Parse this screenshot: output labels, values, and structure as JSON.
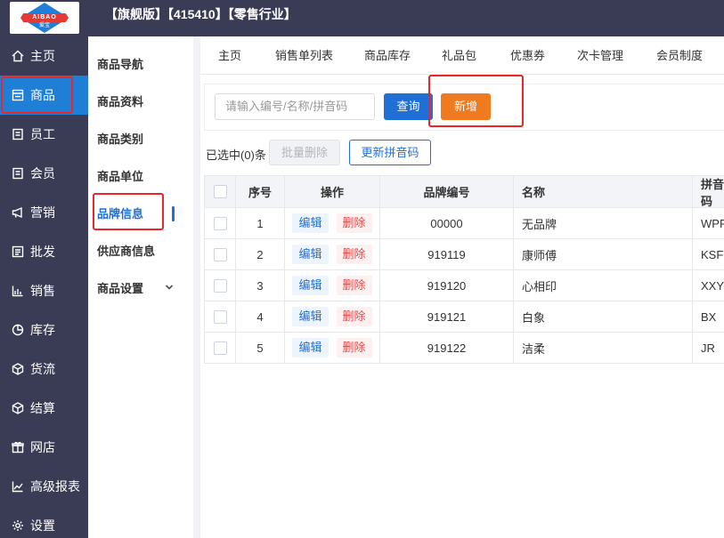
{
  "header": {
    "title": "【旗舰版】【415410】【零售行业】",
    "logo_text": "AIBAO",
    "logo_sub": "爱宝"
  },
  "sidebar": {
    "items": [
      {
        "label": "主页",
        "icon": "home-icon"
      },
      {
        "label": "商品",
        "icon": "goods-icon",
        "active": true
      },
      {
        "label": "员工",
        "icon": "employee-icon"
      },
      {
        "label": "会员",
        "icon": "member-icon"
      },
      {
        "label": "营销",
        "icon": "megaphone-icon"
      },
      {
        "label": "批发",
        "icon": "wholesale-icon"
      },
      {
        "label": "销售",
        "icon": "chart-bar-icon"
      },
      {
        "label": "库存",
        "icon": "pie-icon"
      },
      {
        "label": "货流",
        "icon": "cube-icon"
      },
      {
        "label": "结算",
        "icon": "cube-icon"
      },
      {
        "label": "网店",
        "icon": "gift-icon"
      },
      {
        "label": "高级报表",
        "icon": "line-chart-icon"
      },
      {
        "label": "设置",
        "icon": "gear-icon"
      }
    ]
  },
  "subnav": {
    "items": [
      {
        "label": "商品导航"
      },
      {
        "label": "商品资料"
      },
      {
        "label": "商品类别"
      },
      {
        "label": "商品单位"
      },
      {
        "label": "品牌信息",
        "active": true
      },
      {
        "label": "供应商信息"
      },
      {
        "label": "商品设置",
        "has_children": true
      }
    ]
  },
  "tabs": [
    "主页",
    "销售单列表",
    "商品库存",
    "礼品包",
    "优惠券",
    "次卡管理",
    "会员制度"
  ],
  "search": {
    "placeholder": "请输入编号/名称/拼音码",
    "query_label": "查询",
    "add_label": "新增"
  },
  "toolbar": {
    "selected_text": "已选中(0)条",
    "batch_delete_label": "批量删除",
    "update_pinyin_label": "更新拼音码"
  },
  "table": {
    "columns": [
      "",
      "序号",
      "操作",
      "品牌编号",
      "名称",
      "拼音码"
    ],
    "edit_label": "编辑",
    "delete_label": "删除",
    "rows": [
      {
        "seq": "1",
        "code": "00000",
        "name": "无品牌",
        "pinyin": "WPP"
      },
      {
        "seq": "2",
        "code": "919119",
        "name": "康师傅",
        "pinyin": "KSF"
      },
      {
        "seq": "3",
        "code": "919120",
        "name": "心相印",
        "pinyin": "XXY"
      },
      {
        "seq": "4",
        "code": "919121",
        "name": "白象",
        "pinyin": "BX"
      },
      {
        "seq": "5",
        "code": "919122",
        "name": "洁柔",
        "pinyin": "JR"
      }
    ]
  },
  "colors": {
    "sidebar_bg": "#3a3c56",
    "active_blue": "#1f7fd6",
    "add_orange": "#f07a1f",
    "highlight_red": "#e8262b"
  }
}
